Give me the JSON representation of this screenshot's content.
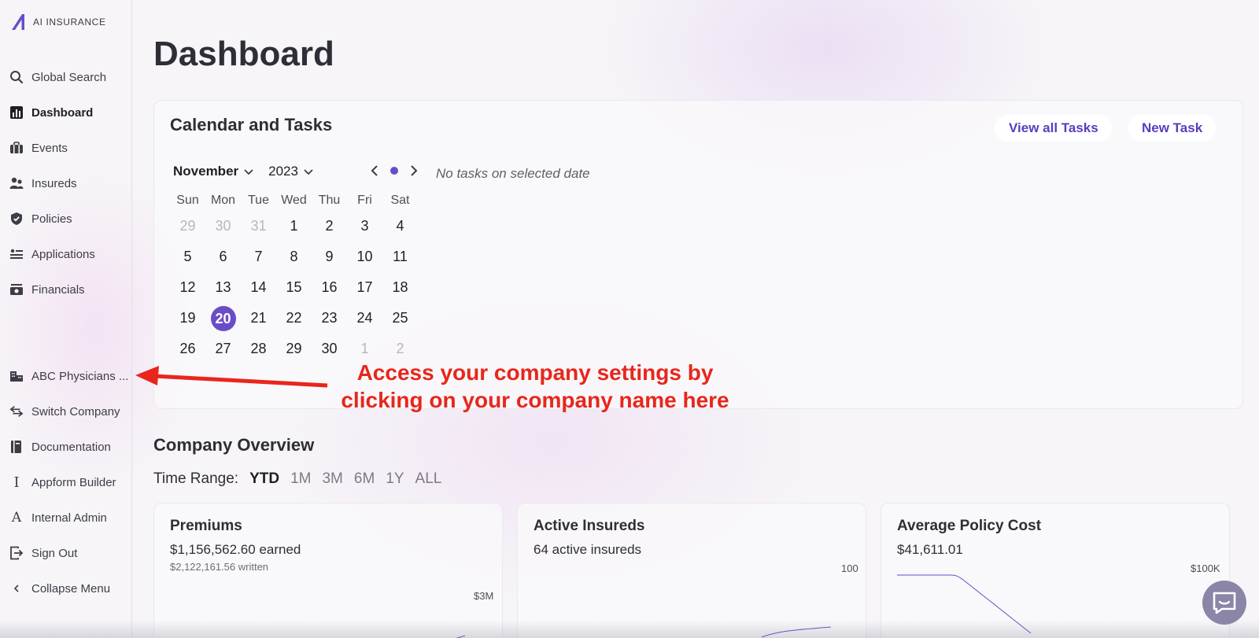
{
  "brand": {
    "name": "AI INSURANCE",
    "accent": "#6a4cc8"
  },
  "sidebar": {
    "items": [
      {
        "label": "Global Search",
        "icon": "search-icon"
      },
      {
        "label": "Dashboard",
        "icon": "chart-icon",
        "active": true
      },
      {
        "label": "Events",
        "icon": "briefcase-icon"
      },
      {
        "label": "Insureds",
        "icon": "users-icon"
      },
      {
        "label": "Policies",
        "icon": "shield-icon"
      },
      {
        "label": "Applications",
        "icon": "list-icon"
      },
      {
        "label": "Financials",
        "icon": "money-icon"
      }
    ],
    "bottom_items": [
      {
        "label": "ABC Physicians ...",
        "icon": "building-icon"
      },
      {
        "label": "Switch Company",
        "icon": "swap-icon"
      },
      {
        "label": "Documentation",
        "icon": "book-icon"
      },
      {
        "label": "Appform Builder",
        "icon": "text-cursor-icon"
      },
      {
        "label": "Internal Admin",
        "icon": "admin-icon"
      },
      {
        "label": "Sign Out",
        "icon": "sign-out-icon"
      },
      {
        "label": "Collapse Menu",
        "icon": "chevron-left-icon"
      }
    ]
  },
  "page": {
    "title": "Dashboard"
  },
  "calendar": {
    "title": "Calendar and Tasks",
    "view_all_label": "View all Tasks",
    "new_task_label": "New Task",
    "month": "November",
    "year": "2023",
    "no_tasks_text": "No tasks on selected date",
    "weekdays": [
      "Sun",
      "Mon",
      "Tue",
      "Wed",
      "Thu",
      "Fri",
      "Sat"
    ],
    "weeks": [
      [
        "29",
        "30",
        "31",
        "1",
        "2",
        "3",
        "4"
      ],
      [
        "5",
        "6",
        "7",
        "8",
        "9",
        "10",
        "11"
      ],
      [
        "12",
        "13",
        "14",
        "15",
        "16",
        "17",
        "18"
      ],
      [
        "19",
        "20",
        "21",
        "22",
        "23",
        "24",
        "25"
      ],
      [
        "26",
        "27",
        "28",
        "29",
        "30",
        "1",
        "2"
      ]
    ],
    "selected_day": "20"
  },
  "annotation": {
    "line1": "Access your company settings by",
    "line2": "clicking on your company name here",
    "color": "#e8261b"
  },
  "overview": {
    "title": "Company Overview",
    "time_range_label": "Time Range:",
    "time_ranges": [
      "YTD",
      "1M",
      "3M",
      "6M",
      "1Y",
      "ALL"
    ],
    "active_range": "YTD",
    "cards": [
      {
        "title": "Premiums",
        "value": "$1,156,562.60 earned",
        "sub": "$2,122,161.56 written",
        "axis_max": "$3M"
      },
      {
        "title": "Active Insureds",
        "value": "64 active insureds",
        "sub": "",
        "axis_max": "100"
      },
      {
        "title": "Average Policy Cost",
        "value": "$41,611.01",
        "sub": "",
        "axis_max": "$100K"
      }
    ]
  },
  "chat": {
    "icon": "chat-icon"
  }
}
